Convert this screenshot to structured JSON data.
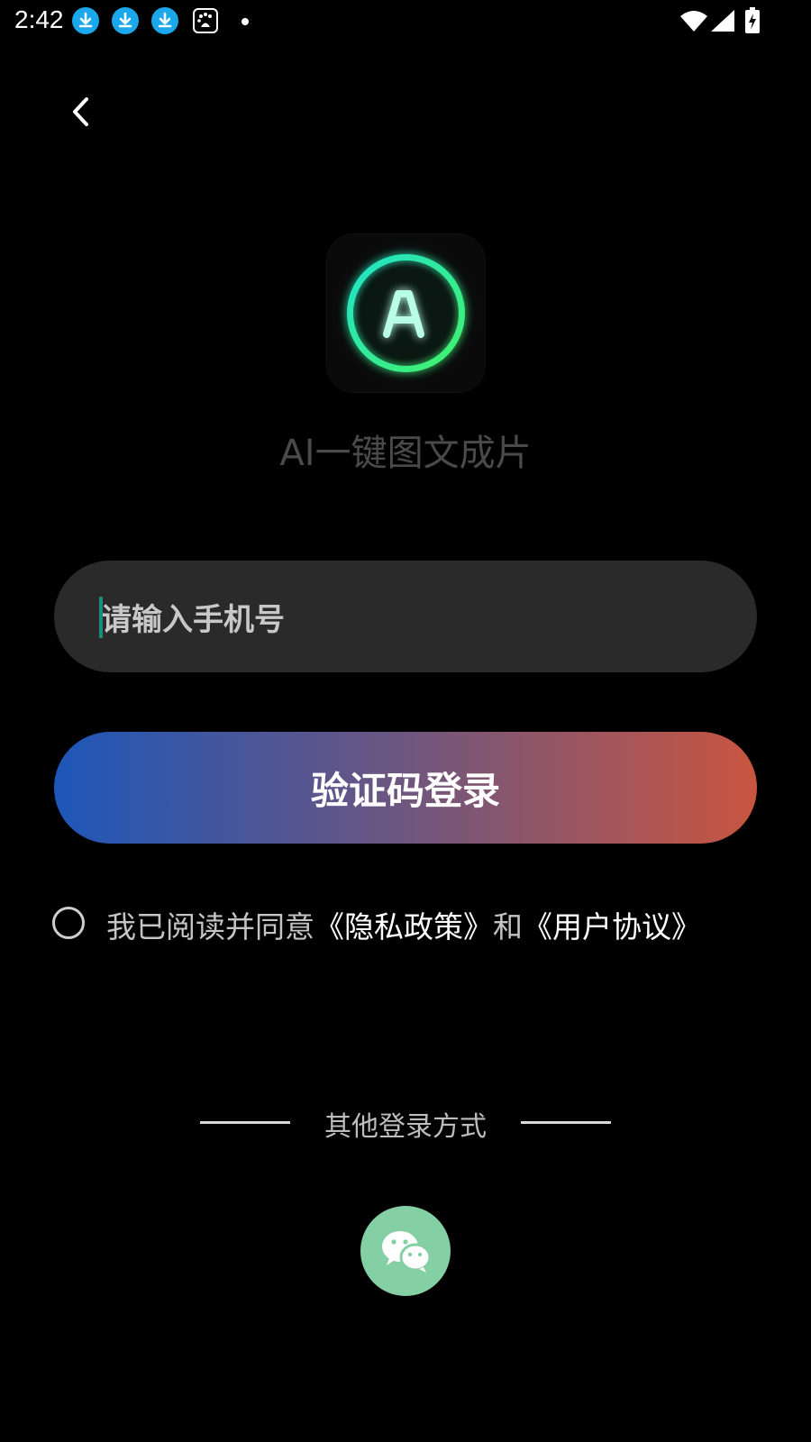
{
  "status_bar": {
    "time": "2:42",
    "notification_icons": [
      "download-icon",
      "download-icon",
      "download-icon",
      "baidu-icon",
      "dot-icon"
    ],
    "system_icons": [
      "wifi-icon",
      "signal-icon",
      "battery-charging-icon"
    ]
  },
  "header": {
    "back_icon": "chevron-left-icon"
  },
  "brand": {
    "logo_text": "AI",
    "app_name": "AI一键图文成片",
    "logo_glow_color": "#39f07a"
  },
  "login_form": {
    "phone_placeholder": "请输入手机号",
    "phone_value": "",
    "submit_label": "验证码登录",
    "gradient_colors": [
      "#1d57b8",
      "#c95540"
    ]
  },
  "agreement": {
    "checked": false,
    "prefix": "我已阅读并同意",
    "privacy_link": "《隐私政策》",
    "conjunction": "和",
    "terms_link": "《用户协议》"
  },
  "other_login": {
    "label": "其他登录方式",
    "wechat_icon": "wechat-icon",
    "wechat_color": "#84cfa3"
  }
}
